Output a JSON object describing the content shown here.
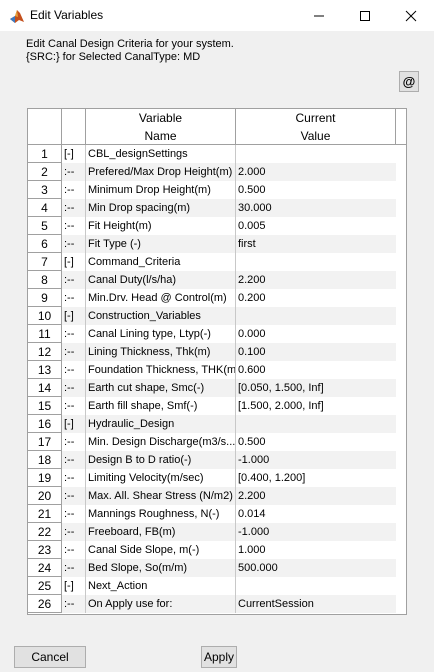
{
  "window": {
    "title": "Edit Variables"
  },
  "description": {
    "line1": "Edit Canal Design Criteria for your system.",
    "line2": "{SRC:} for Selected CanalType: MD"
  },
  "at_button_label": "@",
  "table": {
    "headers": {
      "variable": [
        "Variable",
        "Name"
      ],
      "value": [
        "Current",
        "Value"
      ]
    },
    "rows": [
      {
        "num": "1",
        "tree": "[-]",
        "name": "CBL_designSettings",
        "value": ""
      },
      {
        "num": "2",
        "tree": ":--",
        "name": "Prefered/Max Drop Height(m)",
        "value": "2.000"
      },
      {
        "num": "3",
        "tree": ":--",
        "name": "Minimum Drop Height(m)",
        "value": "0.500"
      },
      {
        "num": "4",
        "tree": ":--",
        "name": "Min Drop spacing(m)",
        "value": "30.000"
      },
      {
        "num": "5",
        "tree": ":--",
        "name": "Fit Height(m)",
        "value": "0.005"
      },
      {
        "num": "6",
        "tree": ":--",
        "name": "Fit Type (-)",
        "value": "first"
      },
      {
        "num": "7",
        "tree": "[-]",
        "name": "Command_Criteria",
        "value": ""
      },
      {
        "num": "8",
        "tree": ":--",
        "name": "Canal Duty(l/s/ha)",
        "value": "2.200"
      },
      {
        "num": "9",
        "tree": ":--",
        "name": "Min.Drv. Head @ Control(m)",
        "value": "0.200"
      },
      {
        "num": "10",
        "tree": "[-]",
        "name": "Construction_Variables",
        "value": ""
      },
      {
        "num": "11",
        "tree": ":--",
        "name": "Canal Lining type, Ltyp(-)",
        "value": "0.000"
      },
      {
        "num": "12",
        "tree": ":--",
        "name": "Lining Thickness, Thk(m)",
        "value": "0.100"
      },
      {
        "num": "13",
        "tree": ":--",
        "name": "Foundation Thickness, THK(m)",
        "value": "0.600"
      },
      {
        "num": "14",
        "tree": ":--",
        "name": "Earth cut shape, Smc(-)",
        "value": "[0.050, 1.500, Inf]"
      },
      {
        "num": "15",
        "tree": ":--",
        "name": "Earth fill shape, Smf(-)",
        "value": "[1.500, 2.000, Inf]"
      },
      {
        "num": "16",
        "tree": "[-]",
        "name": "Hydraulic_Design",
        "value": ""
      },
      {
        "num": "17",
        "tree": ":--",
        "name": "Min. Design Discharge(m3/s...",
        "value": "0.500"
      },
      {
        "num": "18",
        "tree": ":--",
        "name": "Design B to D ratio(-)",
        "value": "-1.000"
      },
      {
        "num": "19",
        "tree": ":--",
        "name": "Limiting Velocity(m/sec)",
        "value": "[0.400, 1.200]"
      },
      {
        "num": "20",
        "tree": ":--",
        "name": "Max. All. Shear Stress (N/m2)",
        "value": "2.200"
      },
      {
        "num": "21",
        "tree": ":--",
        "name": "Mannings Roughness, N(-)",
        "value": "0.014"
      },
      {
        "num": "22",
        "tree": ":--",
        "name": "Freeboard, FB(m)",
        "value": "-1.000"
      },
      {
        "num": "23",
        "tree": ":--",
        "name": "Canal Side Slope, m(-)",
        "value": "1.000"
      },
      {
        "num": "24",
        "tree": ":--",
        "name": "Bed Slope, So(m/m)",
        "value": "500.000"
      },
      {
        "num": "25",
        "tree": "[-]",
        "name": "Next_Action",
        "value": ""
      },
      {
        "num": "26",
        "tree": ":--",
        "name": "On Apply use for:",
        "value": "CurrentSession"
      }
    ]
  },
  "buttons": {
    "cancel": "Cancel",
    "apply": "Apply"
  }
}
